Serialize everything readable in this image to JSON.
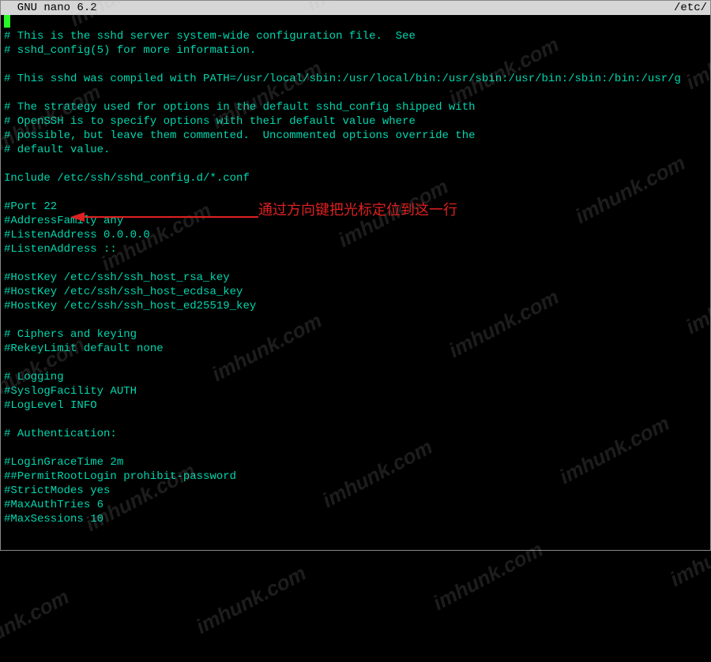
{
  "title_bar": {
    "left": "  GNU nano 6.2",
    "right": "/etc/"
  },
  "editor_lines": [
    "",
    "# This is the sshd server system-wide configuration file.  See",
    "# sshd_config(5) for more information.",
    "",
    "# This sshd was compiled with PATH=/usr/local/sbin:/usr/local/bin:/usr/sbin:/usr/bin:/sbin:/bin:/usr/g",
    "",
    "# The strategy used for options in the default sshd_config shipped with",
    "# OpenSSH is to specify options with their default value where",
    "# possible, but leave them commented.  Uncommented options override the",
    "# default value.",
    "",
    "Include /etc/ssh/sshd_config.d/*.conf",
    "",
    "#Port 22",
    "#AddressFamily any",
    "#ListenAddress 0.0.0.0",
    "#ListenAddress ::",
    "",
    "#HostKey /etc/ssh/ssh_host_rsa_key",
    "#HostKey /etc/ssh/ssh_host_ecdsa_key",
    "#HostKey /etc/ssh/ssh_host_ed25519_key",
    "",
    "# Ciphers and keying",
    "#RekeyLimit default none",
    "",
    "# Logging",
    "#SyslogFacility AUTH",
    "#LogLevel INFO",
    "",
    "# Authentication:",
    "",
    "#LoginGraceTime 2m",
    "##PermitRootLogin prohibit-password",
    "#StrictModes yes",
    "#MaxAuthTries 6",
    "#MaxSessions 10"
  ],
  "annotation": {
    "text": "通过方向键把光标定位到这一行"
  },
  "watermark_text": "imhunk.com"
}
